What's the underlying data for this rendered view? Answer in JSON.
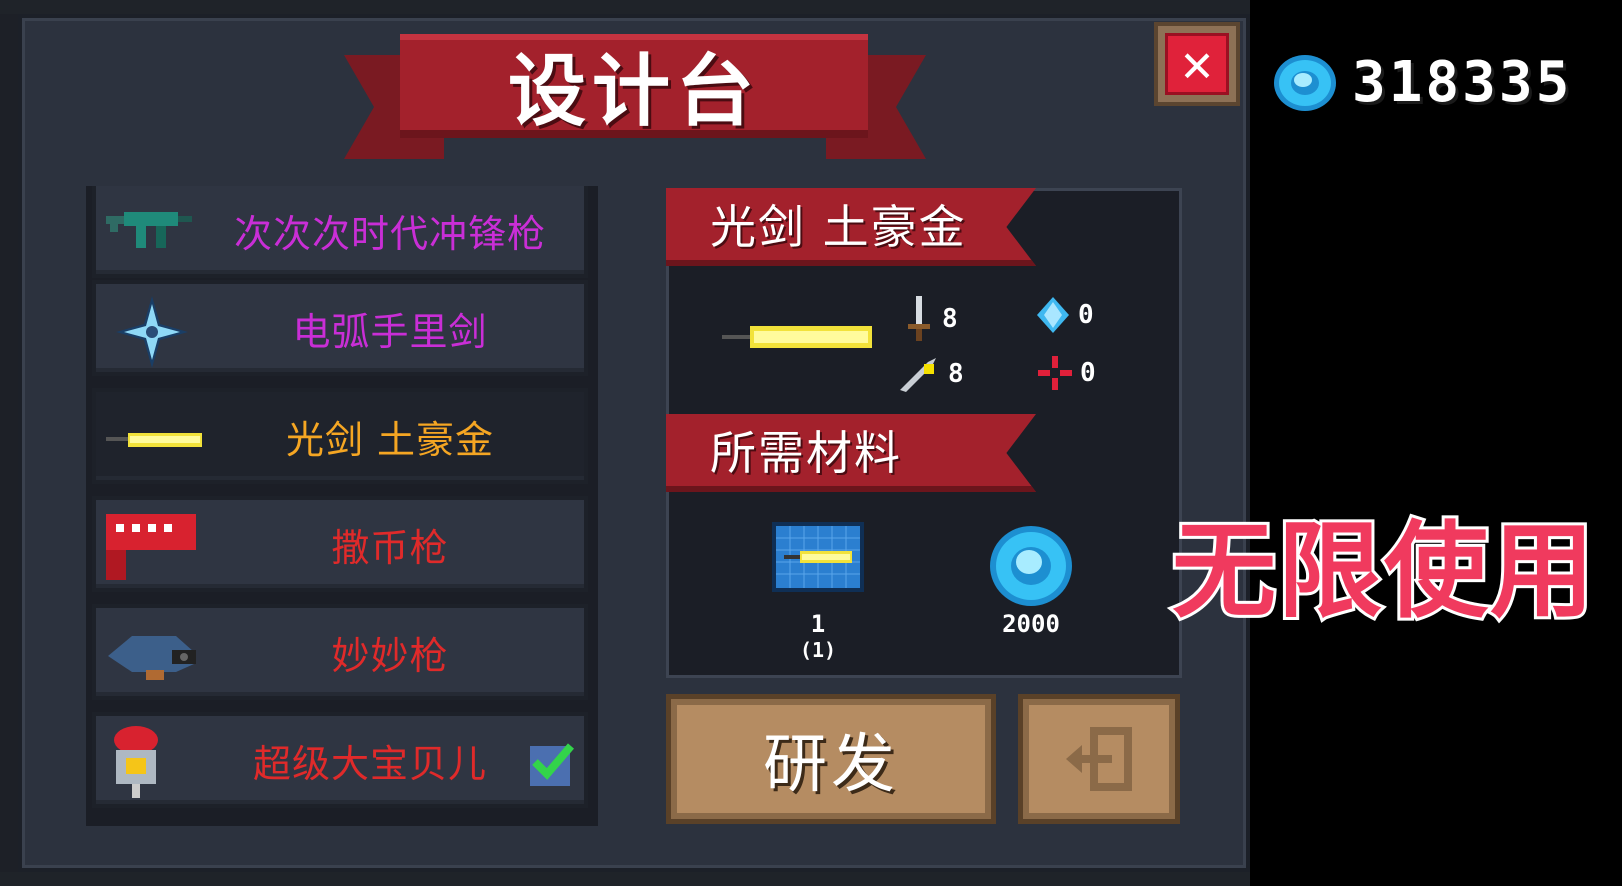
{
  "title": "设计台",
  "gem_count": "318335",
  "weapons": [
    {
      "name": "次次次时代冲锋枪",
      "color": "#c92ed6"
    },
    {
      "name": "电弧手里剑",
      "color": "#c92ed6"
    },
    {
      "name": "光剑 土豪金",
      "color": "#f5a623",
      "selected": true
    },
    {
      "name": "撒币枪",
      "color": "#e02a2a"
    },
    {
      "name": "妙妙枪",
      "color": "#e02a2a"
    },
    {
      "name": "超级大宝贝儿",
      "color": "#e02a2a",
      "owned": true
    }
  ],
  "detail": {
    "name": "光剑 土豪金",
    "stats": {
      "damage": "8",
      "energy": "0",
      "critical": "8",
      "accuracy": "0"
    }
  },
  "materials": {
    "title": "所需材料",
    "blueprint_have": "1",
    "blueprint_need": "(1)",
    "gem_cost": "2000"
  },
  "buttons": {
    "develop": "研发"
  },
  "overlay": "无限使用",
  "icons": [
    "close-icon",
    "gem-icon",
    "smg-icon",
    "shuriken-icon",
    "lightsaber-icon",
    "coin-gun-icon",
    "fish-gun-icon",
    "bomb-baby-icon",
    "check-icon",
    "sword-icon",
    "diamond-icon",
    "knife-icon",
    "crosshair-icon",
    "blueprint-icon",
    "exit-icon"
  ]
}
